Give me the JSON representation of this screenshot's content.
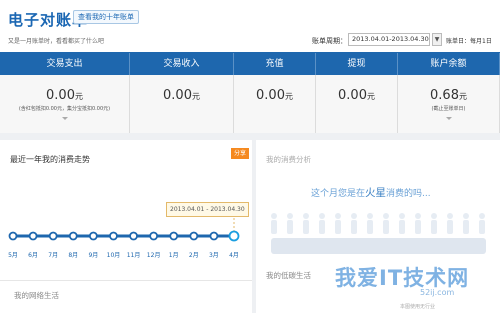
{
  "header": {
    "title": "电子对账单",
    "tenyear_link": "查看我的十年账单",
    "subtitle": "又是一月账单时，看看都买了什么吧",
    "period_label": "账单周期：",
    "period_value": "2013.04.01-2013.04.30",
    "bill_day": "账单日：每月1日"
  },
  "summary": [
    {
      "label": "交易支出",
      "amount": "0.00",
      "unit": "元",
      "note": "(含红包抵扣0.00元，集分宝抵扣0.00元)"
    },
    {
      "label": "交易收入",
      "amount": "0.00",
      "unit": "元",
      "note": ""
    },
    {
      "label": "充值",
      "amount": "0.00",
      "unit": "元",
      "note": ""
    },
    {
      "label": "提现",
      "amount": "0.00",
      "unit": "元",
      "note": ""
    },
    {
      "label": "账户余额",
      "amount": "0.68",
      "unit": "元",
      "note": "(截止至账单日)"
    }
  ],
  "trend": {
    "title": "最近一年我的消费走势",
    "share_label": "分享",
    "tooltip": "2013.04.01 - 2013.04.30",
    "chart_data": {
      "type": "line",
      "categories": [
        "5月",
        "6月",
        "7月",
        "8月",
        "9月",
        "10月",
        "11月",
        "12月",
        "1月",
        "2月",
        "3月",
        "4月"
      ],
      "values": [
        0,
        0,
        0,
        0,
        0,
        0,
        0,
        0,
        0,
        0,
        0,
        0
      ]
    }
  },
  "consume": {
    "title": "我的消费分析",
    "mars_prefix": "这个月您是在",
    "mars_word": "火星",
    "mars_suffix": "消费的吗...",
    "low_carbon": "我的低碳生活"
  },
  "net_life": "我的网络生活",
  "watermark": {
    "main": "我爱IT技术网",
    "sub": "52ij.com",
    "tiny": "本图使用无行业"
  },
  "colors": {
    "brand": "#1e67ae",
    "accent": "#f5891f"
  }
}
